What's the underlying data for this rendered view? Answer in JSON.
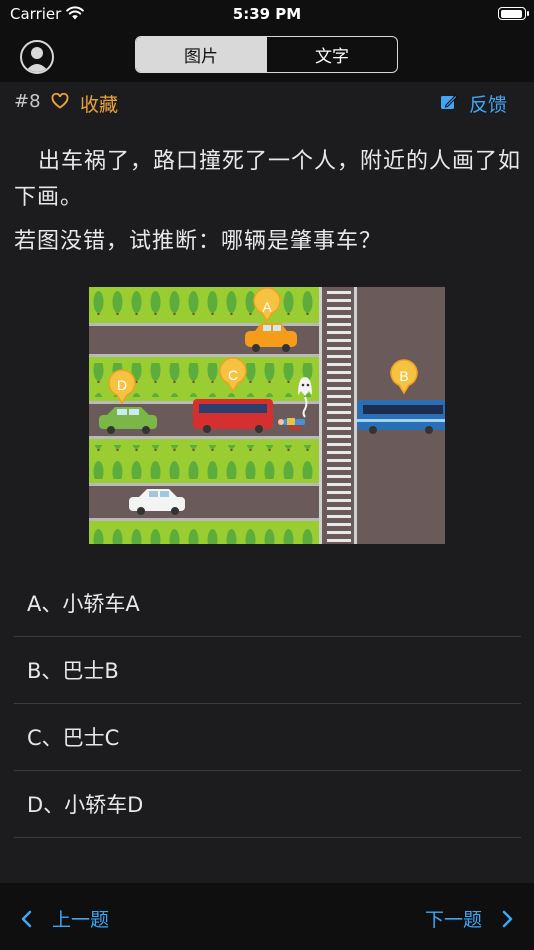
{
  "status": {
    "carrier": "Carrier",
    "time": "5:39 PM",
    "battery_level": 0.9
  },
  "segments": [
    {
      "label": "图片",
      "active": true
    },
    {
      "label": "文字",
      "active": false
    }
  ],
  "meta": {
    "number": "#8",
    "favorite_label": "收藏",
    "feedback_label": "反馈"
  },
  "question": {
    "line1": "出车祸了，路口撞死了一个人，附近的人画了如下画。",
    "line2": "若图没错，试推断：哪辆是肇事车？"
  },
  "picture": {
    "markers": [
      "A",
      "B",
      "C",
      "D"
    ]
  },
  "options": [
    "A、小轿车A",
    "B、巴士B",
    "C、巴士C",
    "D、小轿车D"
  ],
  "nav": {
    "prev_label": "上一题",
    "next_label": "下一题"
  },
  "colors": {
    "accent": "#3fa6f4",
    "favorite": "#e8a33c",
    "background": "#1c1c1e",
    "bar": "#0f0f10"
  }
}
